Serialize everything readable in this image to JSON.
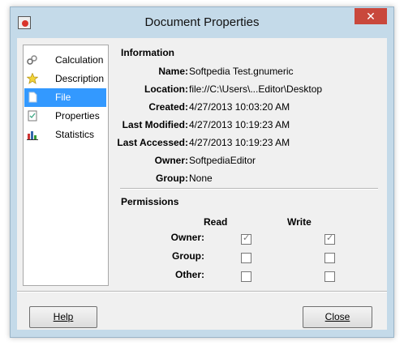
{
  "window": {
    "title": "Document Properties",
    "close_glyph": "✕"
  },
  "sidebar": {
    "items": [
      {
        "label": "Calculation",
        "icon": "calculation-icon"
      },
      {
        "label": "Description",
        "icon": "star-icon"
      },
      {
        "label": "File",
        "icon": "file-icon",
        "selected": true
      },
      {
        "label": "Properties",
        "icon": "properties-icon"
      },
      {
        "label": "Statistics",
        "icon": "statistics-icon"
      }
    ]
  },
  "information": {
    "title": "Information",
    "name_label": "Name:",
    "name": "Softpedia Test.gnumeric",
    "location_label": "Location:",
    "location": "file://C:\\Users\\...Editor\\Desktop",
    "created_label": "Created:",
    "created": "4/27/2013 10:03:20 AM",
    "modified_label": "Last Modified:",
    "modified": "4/27/2013 10:19:23 AM",
    "accessed_label": "Last Accessed:",
    "accessed": "4/27/2013 10:19:23 AM",
    "owner_label": "Owner:",
    "owner": "SoftpediaEditor",
    "group_label": "Group:",
    "group": "None"
  },
  "permissions": {
    "title": "Permissions",
    "read_header": "Read",
    "write_header": "Write",
    "rows": [
      {
        "label": "Owner:",
        "read": true,
        "write": true
      },
      {
        "label": "Group:",
        "read": false,
        "write": false
      },
      {
        "label": "Other:",
        "read": false,
        "write": false
      }
    ]
  },
  "buttons": {
    "help": "Help",
    "close": "Close"
  }
}
